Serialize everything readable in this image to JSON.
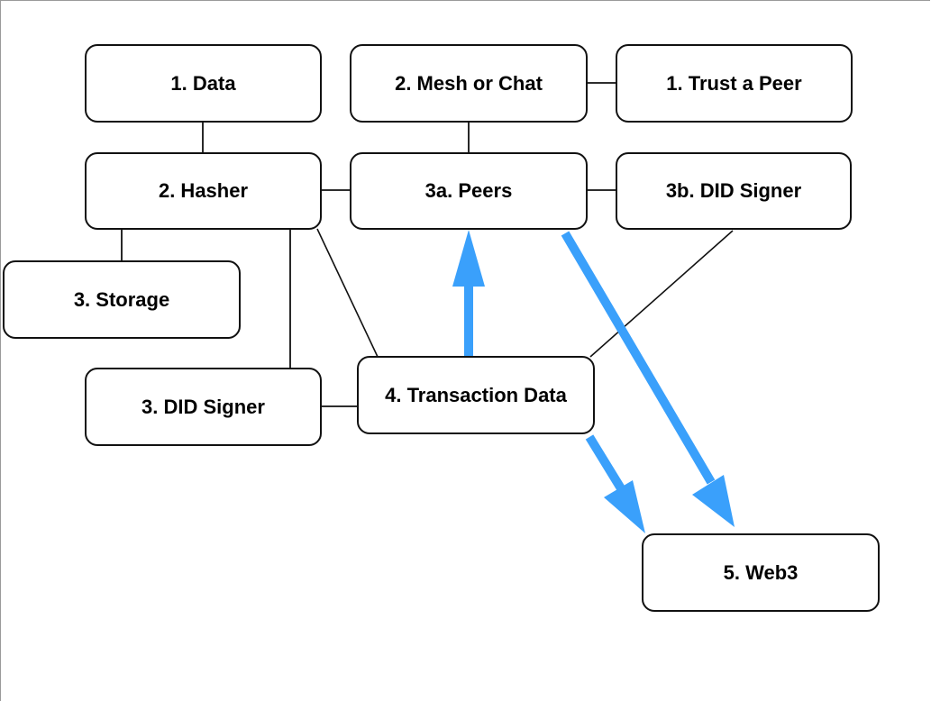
{
  "diagram": {
    "nodes": [
      {
        "id": "data",
        "label": "1. Data"
      },
      {
        "id": "mesh",
        "label": "2. Mesh or Chat"
      },
      {
        "id": "trust",
        "label": "1. Trust a Peer"
      },
      {
        "id": "hasher",
        "label": "2. Hasher"
      },
      {
        "id": "peers",
        "label": "3a. Peers"
      },
      {
        "id": "didsigner3b",
        "label": "3b. DID Signer"
      },
      {
        "id": "storage",
        "label": "3. Storage"
      },
      {
        "id": "didsigner3",
        "label": "3. DID Signer"
      },
      {
        "id": "transaction",
        "label": "4. Transaction Data"
      },
      {
        "id": "web3",
        "label": "5. Web3"
      }
    ],
    "connections": [
      {
        "from": "data",
        "to": "hasher",
        "style": "line"
      },
      {
        "from": "mesh",
        "to": "trust",
        "style": "line"
      },
      {
        "from": "mesh",
        "to": "peers",
        "style": "line"
      },
      {
        "from": "hasher",
        "to": "peers",
        "style": "line"
      },
      {
        "from": "peers",
        "to": "didsigner3b",
        "style": "line"
      },
      {
        "from": "hasher",
        "to": "storage",
        "style": "line"
      },
      {
        "from": "hasher",
        "to": "didsigner3",
        "style": "line"
      },
      {
        "from": "hasher",
        "to": "transaction",
        "style": "line"
      },
      {
        "from": "didsigner3",
        "to": "transaction",
        "style": "line"
      },
      {
        "from": "didsigner3b",
        "to": "transaction",
        "style": "line"
      },
      {
        "from": "transaction",
        "to": "peers",
        "style": "arrow"
      },
      {
        "from": "peers",
        "to": "web3",
        "style": "arrow"
      },
      {
        "from": "transaction",
        "to": "web3",
        "style": "arrow"
      }
    ],
    "colors": {
      "arrow": "#3aa0fb",
      "line": "#111111",
      "border": "#111111"
    }
  }
}
